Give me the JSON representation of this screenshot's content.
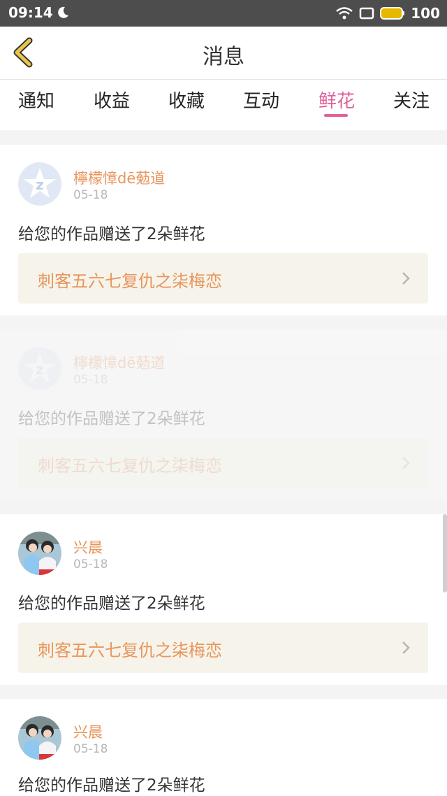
{
  "status_bar": {
    "time": "09:14",
    "battery": "100"
  },
  "header": {
    "title": "消息"
  },
  "tabs": [
    {
      "label": "通知"
    },
    {
      "label": "收益"
    },
    {
      "label": "收藏"
    },
    {
      "label": "互动"
    },
    {
      "label": "鲜花",
      "active": true
    },
    {
      "label": "关注"
    }
  ],
  "messages": [
    {
      "name": "檸檬慞dē葂道",
      "date": "05-18",
      "text": "给您的作品赠送了2朵鲜花",
      "work": "刺客五六七复仇之柒梅恋",
      "avatar": "default-star-avatar"
    },
    {
      "name": "檸檬慞dē葂道",
      "date": "05-18",
      "text": "给您的作品赠送了2朵鲜花",
      "work": "刺客五六七复仇之柒梅恋",
      "avatar": "default-star-avatar"
    },
    {
      "name": "兴晨",
      "date": "05-18",
      "text": "给您的作品赠送了2朵鲜花",
      "work": "刺客五六七复仇之柒梅恋",
      "avatar": "photo-avatar"
    },
    {
      "name": "兴晨",
      "date": "05-18",
      "text": "给您的作品赠送了2朵鲜花",
      "work": "",
      "avatar": "photo-avatar"
    }
  ],
  "colors": {
    "accent": "#e0609a",
    "name": "#e8955d",
    "back_icon": "#e8c64a"
  }
}
